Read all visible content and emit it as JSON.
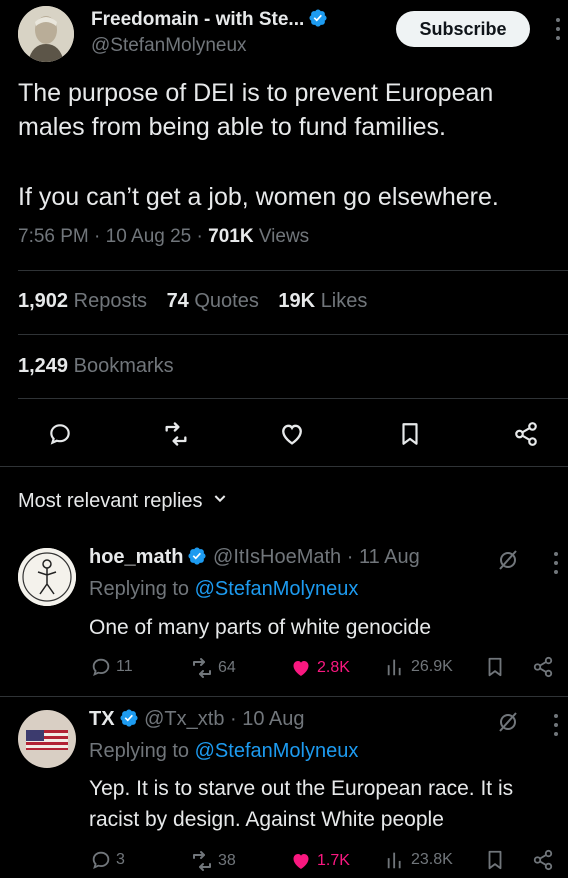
{
  "tweet": {
    "author_name": "Freedomain - with Ste...",
    "author_handle": "@StefanMolyneux",
    "subscribe_label": "Subscribe",
    "text_paragraph_1": "The purpose of DEI is to prevent European males from being able to fund families.",
    "text_paragraph_2": "If you can’t get a job, women go elsewhere.",
    "time": "7:56 PM",
    "date": "10 Aug 25",
    "views_count": "701K",
    "views_label": "Views"
  },
  "stats": {
    "reposts_count": "1,902",
    "reposts_label": "Reposts",
    "quotes_count": "74",
    "quotes_label": "Quotes",
    "likes_count": "19K",
    "likes_label": "Likes",
    "bookmarks_count": "1,249",
    "bookmarks_label": "Bookmarks"
  },
  "replies_header": "Most relevant replies",
  "replies": [
    {
      "name": "hoe_math",
      "handle": "@ItIsHoeMath",
      "date": "11 Aug",
      "replying_prefix": "Replying to",
      "replying_to": "@StefanMolyneux",
      "text": "One of many parts of white genocide",
      "reply_count": "11",
      "repost_count": "64",
      "like_count": "2.8K",
      "view_count": "26.9K"
    },
    {
      "name": "TX",
      "handle": "@Tx_xtb",
      "date": "10 Aug",
      "replying_prefix": "Replying to",
      "replying_to": "@StefanMolyneux",
      "text": "Yep. It is to starve out the European race. It is racist by design. Against White people",
      "reply_count": "3",
      "repost_count": "38",
      "like_count": "1.7K",
      "view_count": "23.8K"
    }
  ],
  "colors": {
    "background": "#000000",
    "text": "#e7e9ea",
    "muted": "#71767b",
    "link": "#1d9bf0",
    "like": "#f91880",
    "divider": "#2f3336"
  },
  "icons": [
    "verified-badge-icon",
    "more-options-icon",
    "reply-icon",
    "repost-icon",
    "like-icon",
    "bookmark-icon",
    "share-icon",
    "chevron-down-icon",
    "grok-icon",
    "views-icon"
  ]
}
